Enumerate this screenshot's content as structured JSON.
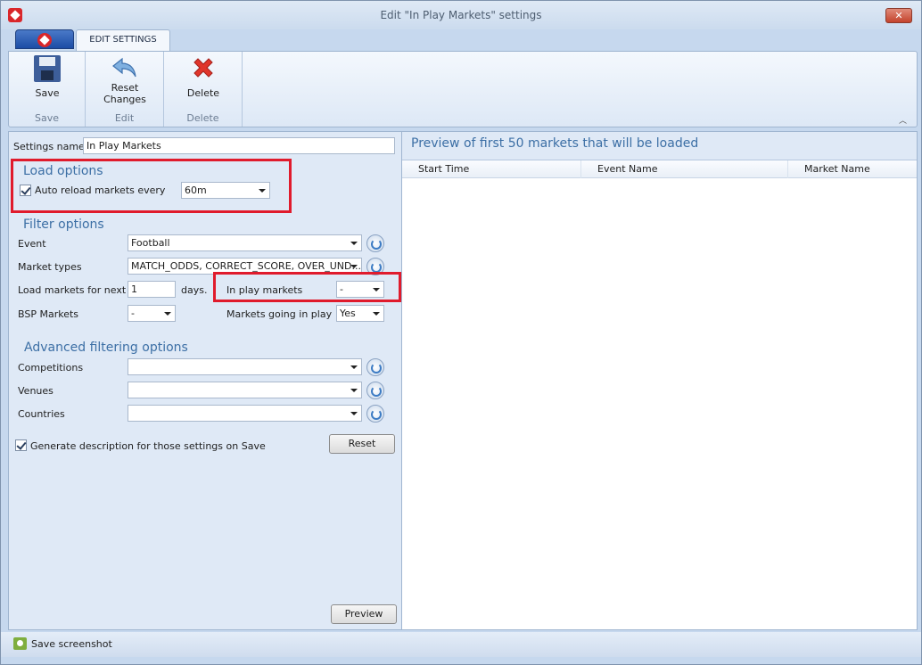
{
  "window": {
    "title": "Edit \"In Play Markets\" settings",
    "close_label": "✕"
  },
  "ribbon": {
    "tab": "EDIT SETTINGS",
    "groups": [
      {
        "button": "Save",
        "group_label": "Save",
        "icon": "floppy-disk-icon"
      },
      {
        "button": "Reset\nChanges",
        "group_label": "Edit",
        "icon": "undo-arrow-icon"
      },
      {
        "button": "Delete",
        "group_label": "Delete",
        "icon": "red-x-icon"
      }
    ]
  },
  "settings": {
    "name_label": "Settings name",
    "name_value": "In Play Markets"
  },
  "load_options": {
    "title": "Load options",
    "auto_reload_label": "Auto reload markets every",
    "auto_reload_checked": true,
    "interval_value": "60m"
  },
  "filter_options": {
    "title": "Filter options",
    "event_label": "Event",
    "event_value": "Football",
    "market_types_label": "Market types",
    "market_types_value": "MATCH_ODDS, CORRECT_SCORE, OVER_UND...",
    "next_label": "Load markets for next",
    "next_value": "1",
    "days_label": "days.",
    "in_play_label": "In play markets",
    "in_play_value": "-",
    "bsp_label": "BSP Markets",
    "bsp_value": "-",
    "going_in_play_label": "Markets going in play",
    "going_in_play_value": "Yes"
  },
  "advanced": {
    "title": "Advanced filtering options",
    "competitions_label": "Competitions",
    "venues_label": "Venues",
    "countries_label": "Countries"
  },
  "generate": {
    "label": "Generate description for those settings on Save",
    "checked": true
  },
  "buttons": {
    "reset": "Reset",
    "preview": "Preview"
  },
  "preview": {
    "title": "Preview of first 50 markets that will be loaded",
    "columns": [
      "Start Time",
      "Event Name",
      "Market Name"
    ]
  },
  "statusbar": {
    "save_screenshot": "Save screenshot"
  },
  "colors": {
    "highlight": "#e01b2c",
    "section_title": "#3c6fa5",
    "pane_bg": "#dfe9f6"
  }
}
